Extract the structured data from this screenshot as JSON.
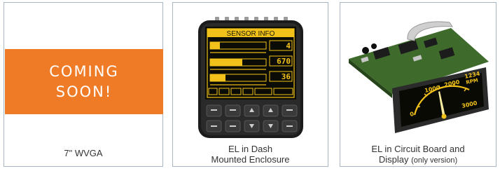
{
  "cards": [
    {
      "banner_line1": "COMING",
      "banner_line2": "SOON!",
      "caption": "7\" WVGA"
    },
    {
      "screen_title": "SENSOR INFO",
      "readouts": [
        "4",
        "670",
        "36"
      ],
      "caption_line1": "EL in Dash",
      "caption_line2": "Mounted Enclosure"
    },
    {
      "gauge_labels": [
        "1000",
        "2000",
        "3000",
        "0"
      ],
      "rpm_value": "1234",
      "rpm_unit": "RPM",
      "caption_line1": "EL in Circuit Board and",
      "caption_line2_main": "Display",
      "caption_line2_note": "(only version)"
    }
  ],
  "colors": {
    "border": "#a9b6c4",
    "banner": "#f07b26",
    "display_amber": "#f2c21a"
  }
}
